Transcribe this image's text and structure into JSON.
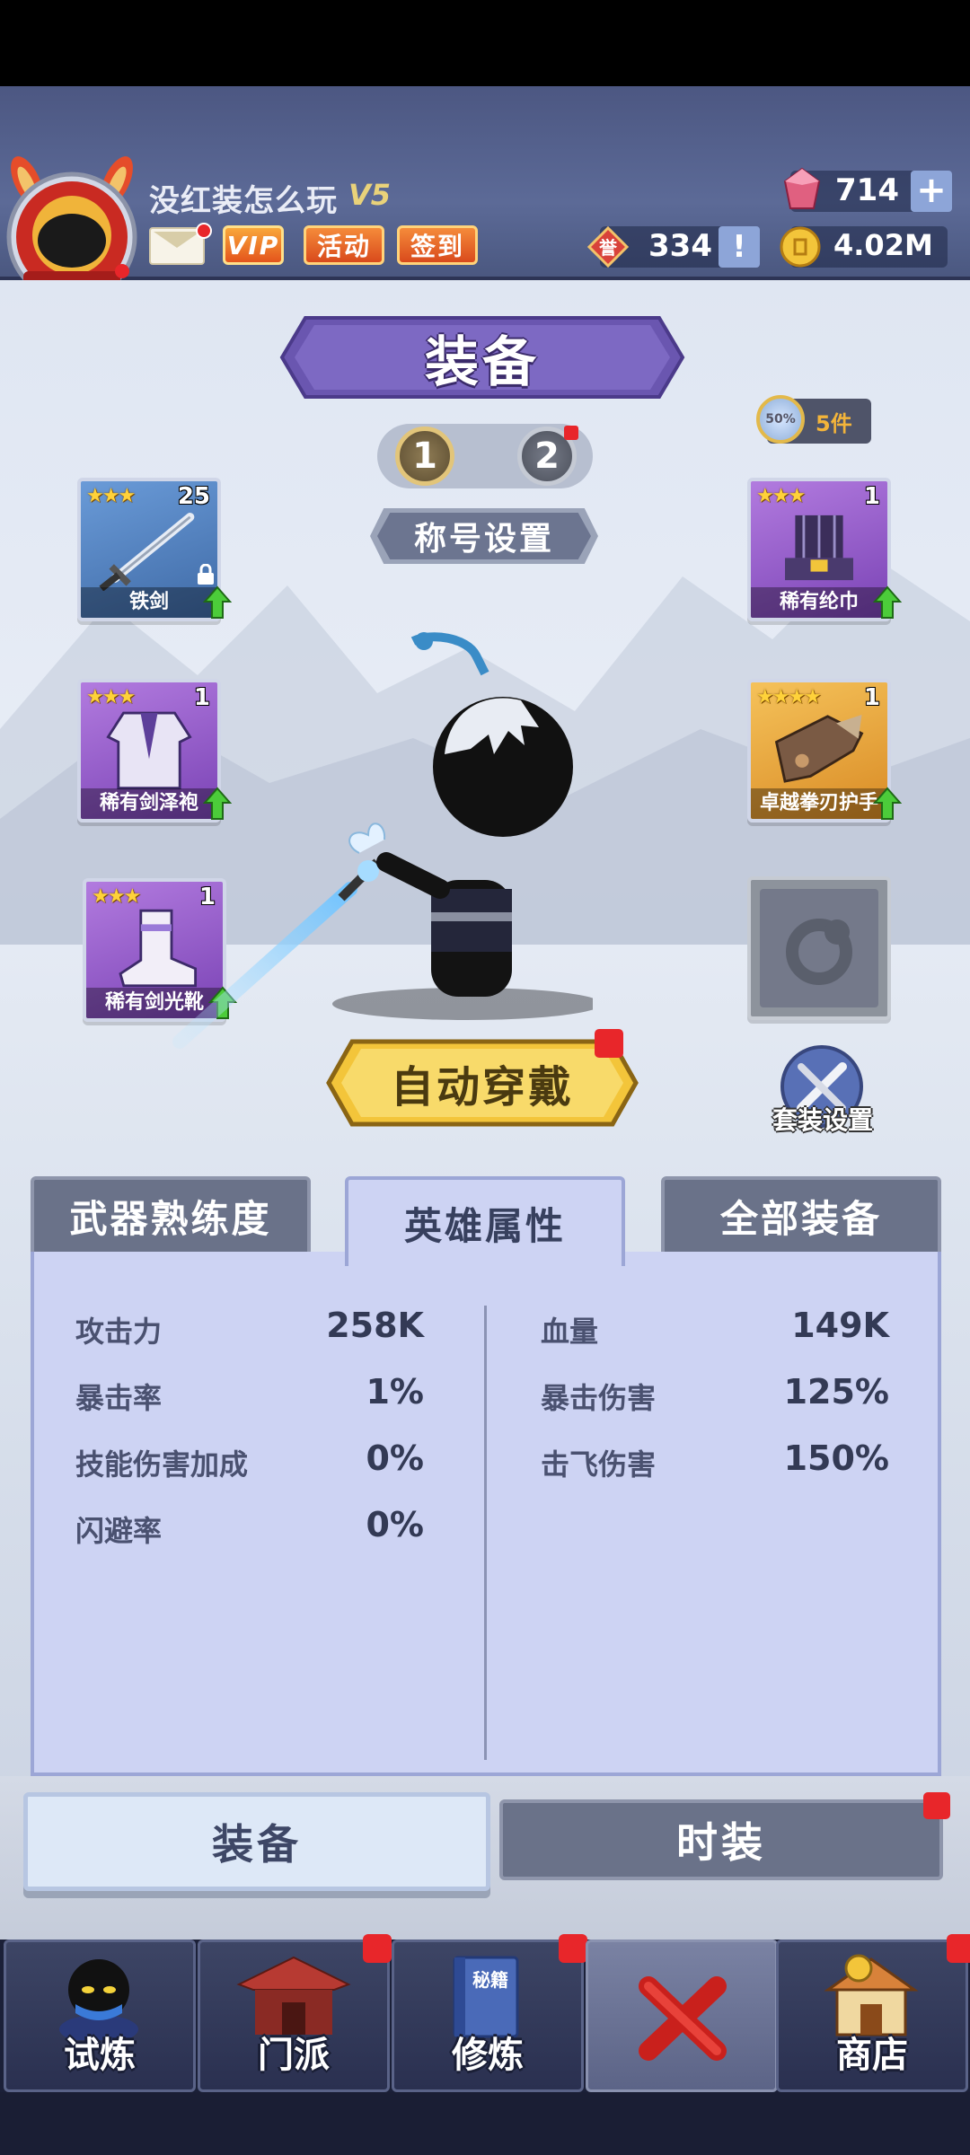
{
  "header": {
    "player_name": "没红装怎么玩",
    "rank": "V5",
    "vip_label": "VIP",
    "activity_label": "活动",
    "sign_in_label": "签到",
    "gems": "714",
    "gem_plus": "+",
    "honor": "334",
    "honor_badge": "誉",
    "honor_info": "!",
    "coins": "4.02M"
  },
  "page_title": "装备",
  "presets": [
    "1",
    "2"
  ],
  "title_setting_label": "称号设置",
  "set_badge": {
    "icon_text": "50%",
    "label": "5件"
  },
  "equipment": {
    "left": [
      {
        "name": "铁剑",
        "stars": "★★★",
        "level": "25",
        "rarity": "blue",
        "locked": true
      },
      {
        "name": "稀有剑泽袍",
        "stars": "★★★",
        "level": "1",
        "rarity": "purple"
      },
      {
        "name": "稀有剑光靴",
        "stars": "★★★",
        "level": "1",
        "rarity": "purple"
      }
    ],
    "right": [
      {
        "name": "稀有纶巾",
        "stars": "★★★",
        "level": "1",
        "rarity": "purple"
      },
      {
        "name": "卓越拳刃护手",
        "stars": "★★★★",
        "level": "1",
        "rarity": "gold"
      }
    ]
  },
  "auto_equip_label": "自动穿戴",
  "suit_setting_label": "套装设置",
  "tabs": {
    "weapon": "武器熟练度",
    "attributes": "英雄属性",
    "all_gear": "全部装备"
  },
  "attributes": {
    "left": [
      {
        "label": "攻击力",
        "value": "258K"
      },
      {
        "label": "暴击率",
        "value": "1%"
      },
      {
        "label": "技能伤害加成",
        "value": "0%"
      },
      {
        "label": "闪避率",
        "value": "0%"
      }
    ],
    "right": [
      {
        "label": "血量",
        "value": "149K"
      },
      {
        "label": "暴击伤害",
        "value": "125%"
      },
      {
        "label": "击飞伤害",
        "value": "150%"
      }
    ]
  },
  "sub_tabs": {
    "equip": "装备",
    "fashion": "时装"
  },
  "nav": [
    {
      "label": "试炼",
      "icon": "ninja-icon"
    },
    {
      "label": "门派",
      "icon": "temple-icon"
    },
    {
      "label": "修炼",
      "icon": "book-icon",
      "book_text": "秘籍"
    },
    {
      "label": "",
      "icon": "close-icon"
    },
    {
      "label": "商店",
      "icon": "shop-icon"
    }
  ],
  "colors": {
    "accent_purple": "#6a56b0",
    "notify_red": "#e8262a",
    "gold": "#f3c53a",
    "panel_bg": "#cdd3f3"
  }
}
